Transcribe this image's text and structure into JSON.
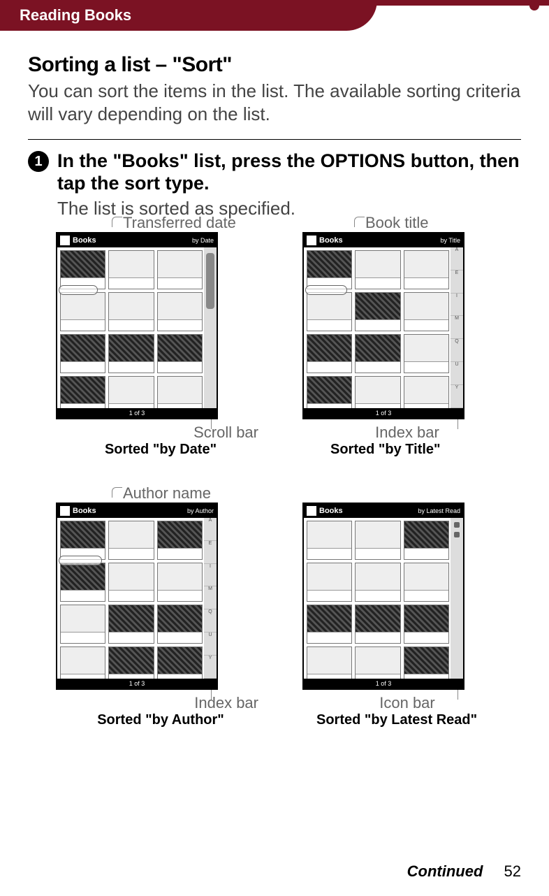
{
  "header": {
    "breadcrumb": "Reading Books"
  },
  "section": {
    "title": "Sorting a list – \"Sort\"",
    "intro": "You can sort the items in the list. The available sorting criteria will vary depending on the list."
  },
  "step": {
    "number": "1",
    "title": "In the \"Books\" list, press the OPTIONS button, then tap the sort type.",
    "subtitle": "The list is sorted as specified."
  },
  "screenshots": {
    "by_date": {
      "top_label": "Transferred date",
      "bottom_label": "Scroll bar",
      "caption": "Sorted \"by Date\"",
      "header_title": "Books",
      "header_right": "by Date",
      "footer": "1 of 3"
    },
    "by_title": {
      "top_label": "Book title",
      "bottom_label": "Index bar",
      "caption": "Sorted \"by Title\"",
      "header_title": "Books",
      "header_right": "by Title",
      "footer": "1 of 3"
    },
    "by_author": {
      "top_label": "Author name",
      "bottom_label": "Index bar",
      "caption": "Sorted \"by Author\"",
      "header_title": "Books",
      "header_right": "by Author",
      "footer": "1 of 3"
    },
    "by_latest": {
      "bottom_label": "Icon bar",
      "caption": "Sorted \"by Latest Read\"",
      "header_title": "Books",
      "header_right": "by Latest Read",
      "footer": "1 of 3"
    }
  },
  "footer": {
    "continued": "Continued",
    "page": "52"
  }
}
